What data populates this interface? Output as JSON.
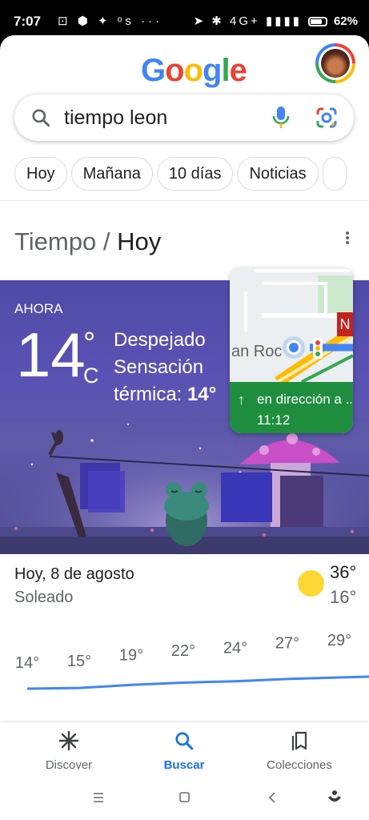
{
  "status_bar": {
    "time": "7:07",
    "left_icons": "⊡ ⬢ ✦ ᵒs ···",
    "right_icons": "➤ ✱ 4G+ ▮▮▮▮",
    "battery": "62%"
  },
  "header": {
    "logo": [
      "G",
      "o",
      "o",
      "g",
      "l",
      "e"
    ]
  },
  "search": {
    "query": "tiempo leon",
    "placeholder": ""
  },
  "chips": [
    "Hoy",
    "Mañana",
    "10 días",
    "Noticias"
  ],
  "card": {
    "title_prefix": "Tiempo",
    "title_sep": " / ",
    "title_strong": "Hoy"
  },
  "weather": {
    "now_label": "AHORA",
    "temperature": "14",
    "degree": "°",
    "unit": "C",
    "condition": "Despejado",
    "feels_like_label_1": "Sensación",
    "feels_like_label_2": "térmica: ",
    "feels_like_value": "14°"
  },
  "map_card": {
    "road_label": "an Roc",
    "badge": "N",
    "direction": "en dirección a ...",
    "eta": "11:12"
  },
  "forecast": {
    "date": "Hoy, 8 de agosto",
    "condition": "Soleado",
    "high": "36°",
    "low": "16°"
  },
  "hourly_temps": [
    {
      "label": "14°",
      "value": 14
    },
    {
      "label": "15°",
      "value": 15
    },
    {
      "label": "19°",
      "value": 19
    },
    {
      "label": "22°",
      "value": 22
    },
    {
      "label": "24°",
      "value": 24
    },
    {
      "label": "27°",
      "value": 27
    },
    {
      "label": "29°",
      "value": 29
    }
  ],
  "bottom_nav": [
    {
      "label": "Discover",
      "icon": "asterisk-icon"
    },
    {
      "label": "Buscar",
      "icon": "search-icon",
      "active": true
    },
    {
      "label": "Colecciones",
      "icon": "collections-icon"
    }
  ],
  "colors": {
    "accent": "#1a73e8",
    "weather_bg": "#5a52b4",
    "directions": "#1e8e3e",
    "temp_line": "#4285f4"
  }
}
